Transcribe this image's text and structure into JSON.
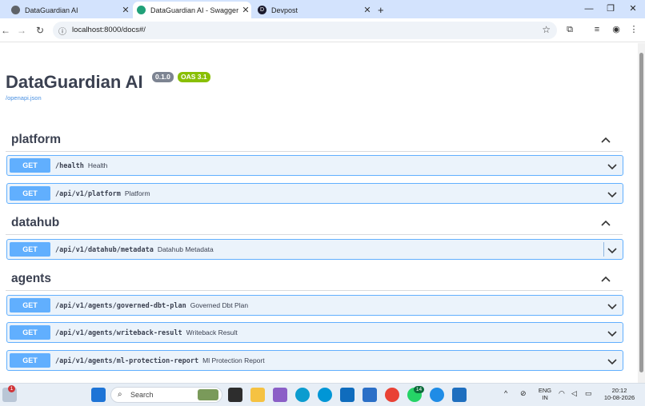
{
  "browser": {
    "tabs": [
      {
        "title": "DataGuardian AI",
        "favicon_color": "#5f6368"
      },
      {
        "title": "DataGuardian AI - Swagger UI",
        "favicon_color": "#21a179"
      },
      {
        "title": "Devpost",
        "favicon_color": "#1a1a2e",
        "favicon_letter": "D"
      }
    ],
    "url": "localhost:8000/docs#/"
  },
  "swagger": {
    "title": "DataGuardian AI",
    "version": "0.1.0",
    "oas": "OAS 3.1",
    "openapi_link": "/openapi.json",
    "tags": [
      {
        "name": "platform",
        "operations": [
          {
            "method": "GET",
            "path": "/health",
            "summary": "Health"
          },
          {
            "method": "GET",
            "path": "/api/v1/platform",
            "summary": "Platform"
          }
        ]
      },
      {
        "name": "datahub",
        "operations": [
          {
            "method": "GET",
            "path": "/api/v1/datahub/metadata",
            "summary": "Datahub Metadata"
          }
        ]
      },
      {
        "name": "agents",
        "operations": [
          {
            "method": "GET",
            "path": "/api/v1/agents/governed-dbt-plan",
            "summary": "Governed Dbt Plan"
          },
          {
            "method": "GET",
            "path": "/api/v1/agents/writeback-result",
            "summary": "Writeback Result"
          },
          {
            "method": "GET",
            "path": "/api/v1/agents/ml-protection-report",
            "summary": "Ml Protection Report"
          }
        ]
      }
    ]
  },
  "taskbar": {
    "search_placeholder": "Search",
    "notification_badge": "1",
    "whatsapp_badge": "14",
    "language": "ENG",
    "region": "IN",
    "time": "20:12",
    "date": "10-08-2026"
  },
  "colors": {
    "get": "#61affe",
    "get_bg": "#ebf3fb",
    "accent_tab": "#d3e3fd"
  }
}
